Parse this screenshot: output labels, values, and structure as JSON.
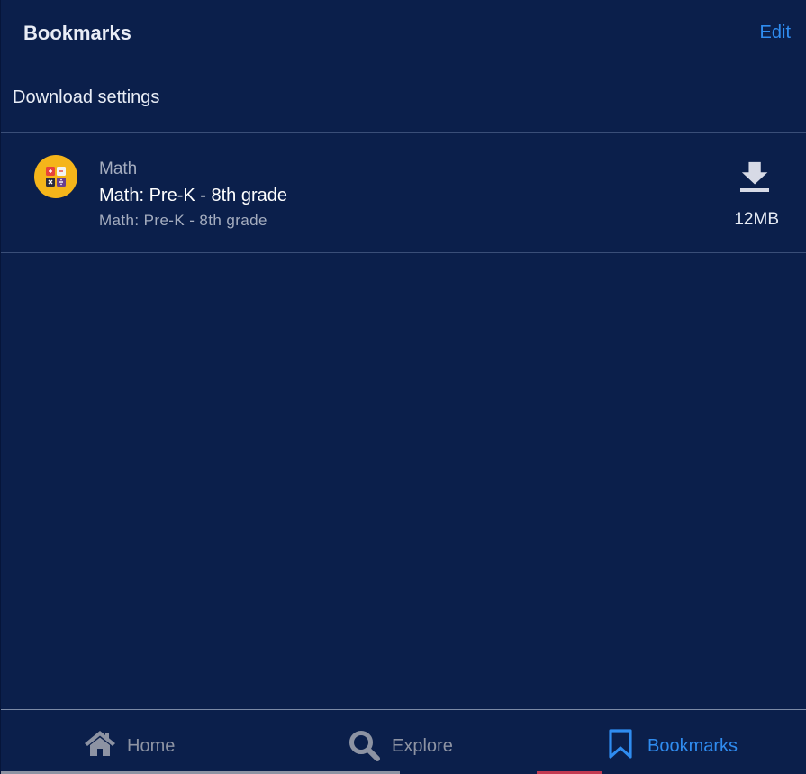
{
  "header": {
    "title": "Bookmarks",
    "edit_label": "Edit"
  },
  "download_settings_label": "Download settings",
  "bookmarks": [
    {
      "category": "Math",
      "title": "Math: Pre-K - 8th grade",
      "subtitle": "Math: Pre-K - 8th grade",
      "size": "12MB",
      "icon": "calculator-icon",
      "download_icon": "download-icon"
    }
  ],
  "nav": {
    "items": [
      {
        "label": "Home",
        "icon": "home-icon",
        "active": false
      },
      {
        "label": "Explore",
        "icon": "search-icon",
        "active": false
      },
      {
        "label": "Bookmarks",
        "icon": "bookmark-icon",
        "active": true
      }
    ]
  },
  "colors": {
    "background": "#0b1f4b",
    "accent": "#2f8cf0",
    "icon_bg": "#f5b51a",
    "muted_text": "#a5adbf",
    "inactive_nav": "#8d93a3"
  }
}
